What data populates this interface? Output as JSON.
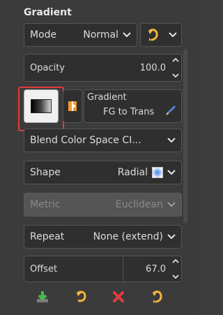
{
  "panel": {
    "title": "Gradient",
    "mode": {
      "label": "Mode",
      "value": "Normal"
    },
    "opacity": {
      "label": "Opacity",
      "value": "100.0"
    },
    "gradient": {
      "label": "Gradient",
      "name": "FG to Trans"
    },
    "blend_color_space": {
      "value": "Blend Color Space CI..."
    },
    "shape": {
      "label": "Shape",
      "value": "Radial"
    },
    "metric": {
      "label": "Metric",
      "value": "Euclidean"
    },
    "repeat": {
      "label": "Repeat",
      "value": "None (extend)"
    },
    "offset": {
      "label": "Offset",
      "value": "67.0"
    }
  },
  "colors": {
    "background": "#3b3b3b",
    "control_bg": "#2f2f2f",
    "highlight_red": "#e23b3b",
    "accent_blue": "#4f86d8"
  },
  "icons": {
    "mode_extra": "reset-arrow-icon",
    "gradient_preview": "gradient-preview-icon",
    "gradient_reverse": "reverse-gradient-icon",
    "gradient_edit": "pencil-icon",
    "shape_preview": "radial-shape-icon",
    "bottom": [
      "save-icon",
      "reset-icon",
      "delete-icon",
      "restore-icon"
    ]
  }
}
